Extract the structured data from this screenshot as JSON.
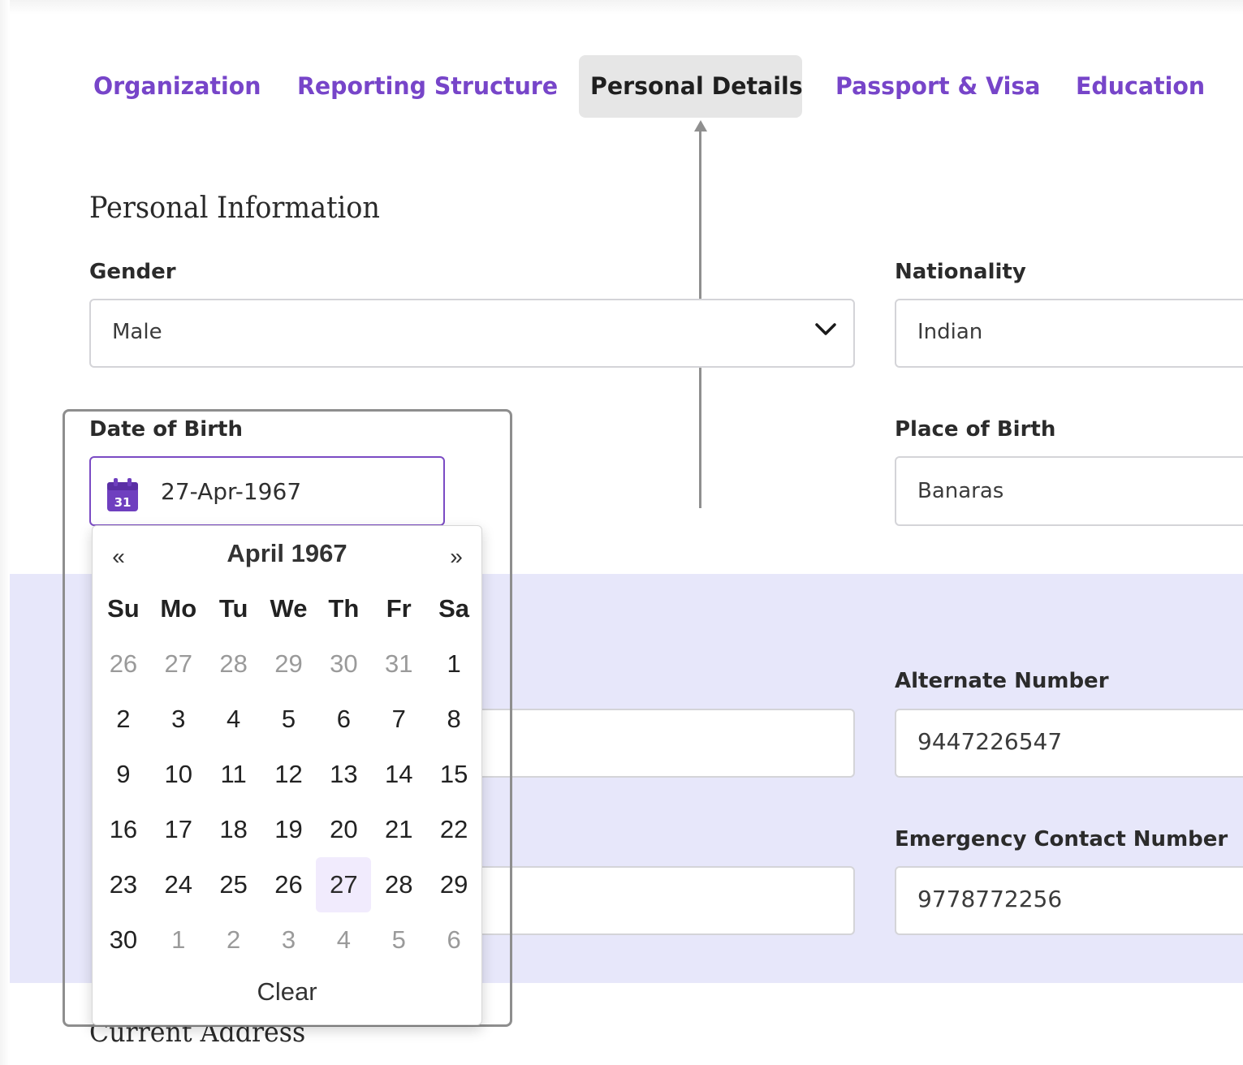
{
  "tabs": [
    {
      "label": "Organization",
      "active": false
    },
    {
      "label": "Reporting Structure",
      "active": false
    },
    {
      "label": "Personal Details",
      "active": true
    },
    {
      "label": "Passport & Visa",
      "active": false
    },
    {
      "label": "Education",
      "active": false
    }
  ],
  "personal_information": {
    "title": "Personal Information",
    "gender": {
      "label": "Gender",
      "value": "Male"
    },
    "nationality": {
      "label": "Nationality",
      "value": "Indian"
    },
    "date_of_birth": {
      "label": "Date of Birth",
      "value": "27-Apr-1967"
    },
    "place_of_birth": {
      "label": "Place of Birth",
      "value": "Banaras"
    }
  },
  "contact": {
    "alternate_number": {
      "label": "Alternate Number",
      "value": "9447226547"
    },
    "emergency_contact_number": {
      "label": "Emergency Contact Number",
      "value": "9778772256"
    }
  },
  "current_address": {
    "title": "Current Address"
  },
  "datepicker": {
    "prev": "«",
    "next": "»",
    "title": "April 1967",
    "weekdays": [
      "Su",
      "Mo",
      "Tu",
      "We",
      "Th",
      "Fr",
      "Sa"
    ],
    "weeks": [
      [
        "26",
        "27",
        "28",
        "29",
        "30",
        "31",
        "1"
      ],
      [
        "2",
        "3",
        "4",
        "5",
        "6",
        "7",
        "8"
      ],
      [
        "9",
        "10",
        "11",
        "12",
        "13",
        "14",
        "15"
      ],
      [
        "16",
        "17",
        "18",
        "19",
        "20",
        "21",
        "22"
      ],
      [
        "23",
        "24",
        "25",
        "26",
        "27",
        "28",
        "29"
      ],
      [
        "30",
        "1",
        "2",
        "3",
        "4",
        "5",
        "6"
      ]
    ],
    "selected_day": "27",
    "clear_label": "Clear"
  },
  "calendar_icon_day": "31",
  "colors": {
    "accent": "#7745c9",
    "band": "#e7e7fa",
    "selected": "#f1ebfd"
  }
}
